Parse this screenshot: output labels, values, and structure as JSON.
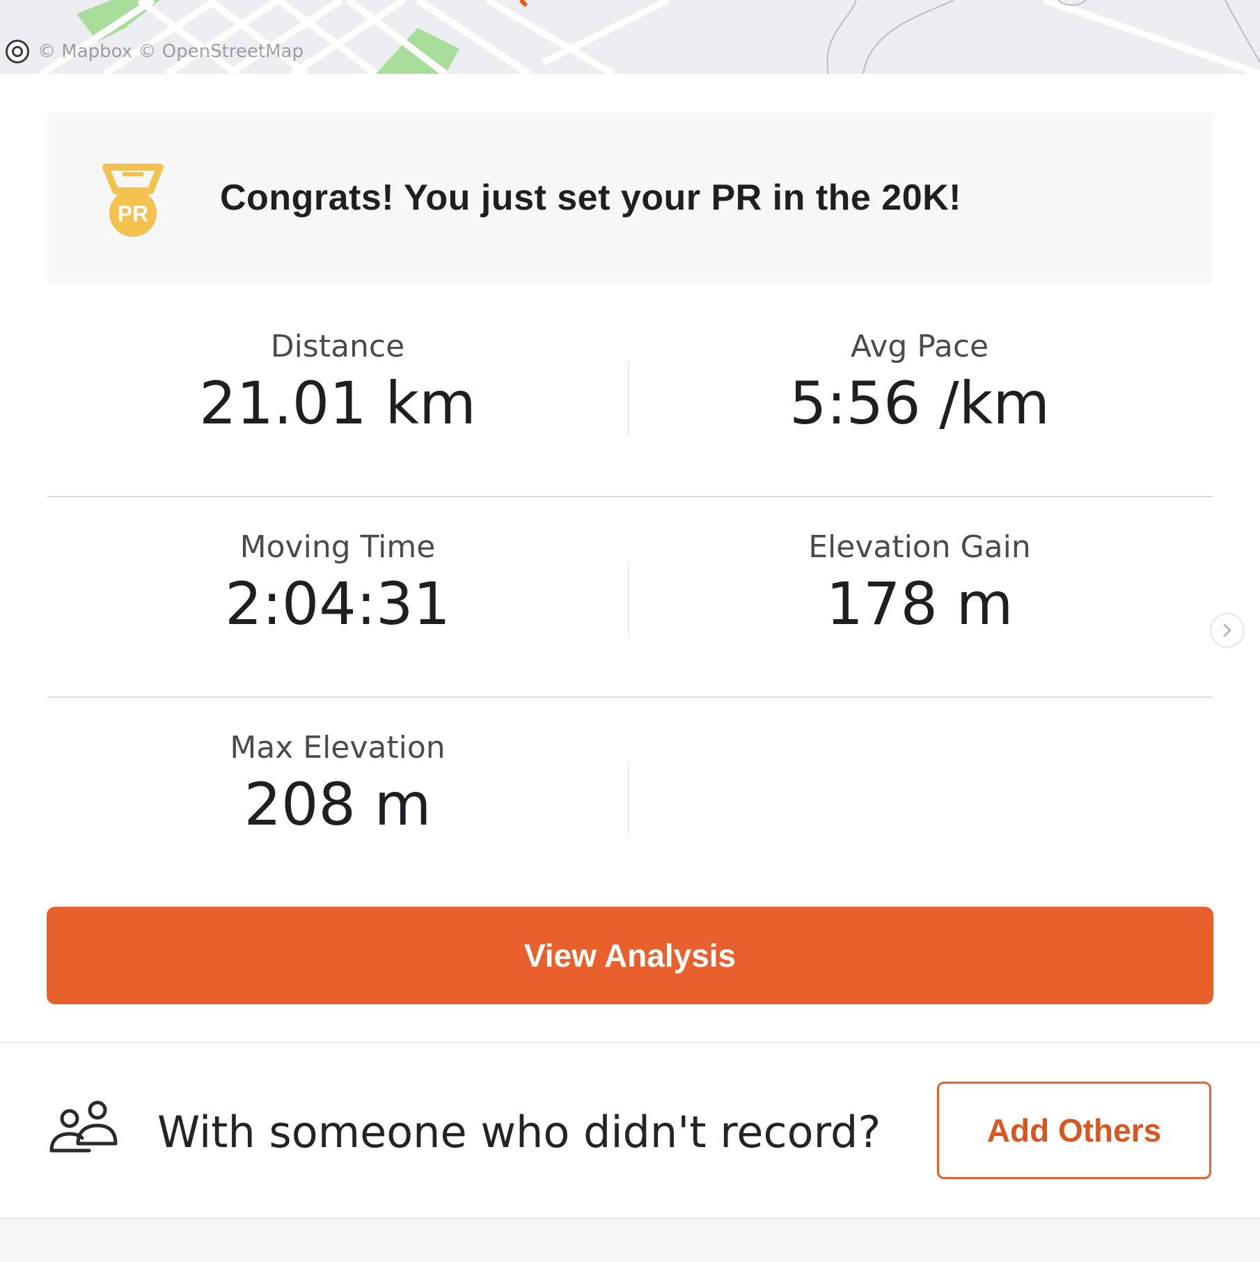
{
  "map": {
    "attribution": "© Mapbox © OpenStreetMap",
    "route_color": "#fc5200"
  },
  "pr_banner": {
    "icon": "pr-medal-icon",
    "medal_label": "PR",
    "text": "Congrats! You just set your PR in the 20K!"
  },
  "stats": [
    {
      "label": "Distance",
      "value": "21.01 km"
    },
    {
      "label": "Avg Pace",
      "value": "5:56 /km"
    },
    {
      "label": "Moving Time",
      "value": "2:04:31"
    },
    {
      "label": "Elevation Gain",
      "value": "178 m"
    },
    {
      "label": "Max Elevation",
      "value": "208 m"
    }
  ],
  "actions": {
    "view_analysis": "View Analysis"
  },
  "with_others": {
    "icon": "people-icon",
    "text": "With someone who didn't record?",
    "button": "Add Others"
  },
  "colors": {
    "accent": "#e8612c",
    "medal": "#f3c14e"
  }
}
